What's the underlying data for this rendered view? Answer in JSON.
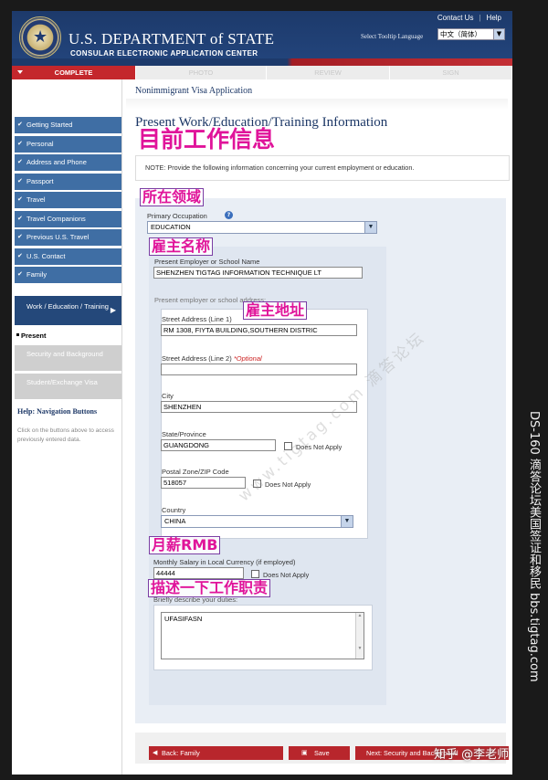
{
  "header": {
    "contact_us": "Contact Us",
    "help": "Help",
    "department": "U.S. DEPARTMENT of STATE",
    "subtitle": "CONSULAR ELECTRONIC APPLICATION CENTER",
    "tooltip_label": "Select Tooltip Language",
    "language_selected": "中文（简体）"
  },
  "progress_steps": [
    "COMPLETE",
    "PHOTO",
    "REVIEW",
    "SIGN"
  ],
  "nav": {
    "items": [
      "Getting Started",
      "Personal",
      "Address and Phone",
      "Passport",
      "Travel",
      "Travel Companions",
      "Previous U.S. Travel",
      "U.S. Contact",
      "Family"
    ],
    "current_section": "Work / Education / Training",
    "current_page": "Present",
    "disabled_items": [
      "Security and Background",
      "Student/Exchange Visa"
    ],
    "help_title": "Help: Navigation Buttons",
    "help_text": "Click on the buttons above to access previously entered data."
  },
  "main": {
    "app_name": "Nonimmigrant Visa Application",
    "page_title": "Present Work/Education/Training Information",
    "note": "NOTE: Provide the following information concerning your current employment or education.",
    "primary_occupation_label": "Primary Occupation",
    "primary_occupation_value": "EDUCATION",
    "employer_label": "Present Employer or School Name",
    "employer_value": "SHENZHEN TIGTAG INFORMATION TECHNIQUE LT",
    "address_section_label": "Present employer or school address:",
    "street1_label": "Street Address (Line 1)",
    "street1_value": "RM 1308, FIYTA BUILDING,SOUTHERN DISTRIC",
    "street2_label": "Street Address (Line 2)",
    "street2_optional": "*Optional",
    "street2_value": "",
    "city_label": "City",
    "city_value": "SHENZHEN",
    "state_label": "State/Province",
    "state_value": "GUANGDONG",
    "does_not_apply": "Does Not Apply",
    "postal_label": "Postal Zone/ZIP Code",
    "postal_value": "518057",
    "country_label": "Country",
    "country_value": "CHINA",
    "salary_label": "Monthly Salary in Local Currency (if employed)",
    "salary_value": "44444",
    "duties_label": "Briefly describe your duties:",
    "duties_value": "UFASIFASN"
  },
  "annotations": {
    "title": "目前工作信息",
    "field": "所在领域",
    "employer": "雇主名称",
    "address": "雇主地址",
    "salary": "月薪RMB",
    "duties": "描述一下工作职责"
  },
  "watermark": "www.tigtag.com 滴答论坛",
  "buttons": {
    "back": "Back: Family",
    "save": "Save",
    "next": "Next: Security and Background"
  },
  "side_caption": "DS-160 滴答论坛美国签证和移民 bbs.tigtag.com",
  "zhihu_credit": "知乎 @李老师"
}
